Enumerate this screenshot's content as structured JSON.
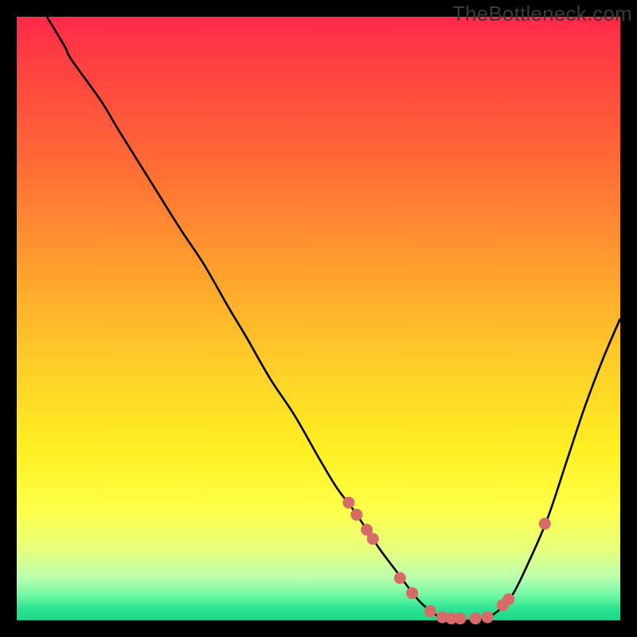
{
  "watermark": "TheBottleneck.com",
  "colors": {
    "curve_stroke": "#000000",
    "point_fill": "#d96a6a",
    "point_stroke": "#d96a6a"
  },
  "chart_data": {
    "type": "line",
    "title": "",
    "xlabel": "",
    "ylabel": "",
    "xlim": [
      0,
      100
    ],
    "ylim": [
      0,
      100
    ],
    "grid": false,
    "legend": false,
    "series": [
      {
        "name": "bottleneck-curve",
        "x": [
          5,
          8,
          9,
          14,
          17,
          22,
          27,
          31,
          35,
          38,
          42,
          46,
          50,
          53,
          56,
          60,
          63,
          66,
          68,
          71,
          73,
          76,
          79,
          82,
          85,
          88,
          91,
          94,
          97,
          100
        ],
        "y": [
          100,
          95,
          93,
          86,
          81,
          73,
          65,
          59,
          52,
          47,
          40,
          34,
          27,
          22,
          18,
          12,
          8,
          4,
          2,
          0,
          0,
          0,
          1,
          4,
          10,
          17,
          26,
          35,
          43,
          50
        ]
      }
    ],
    "points": {
      "name": "highlight-points",
      "r": 7,
      "x": [
        55.0,
        56.3,
        58.0,
        59.0,
        63.5,
        65.5,
        68.5,
        70.5,
        72.0,
        73.5,
        76.0,
        78.0,
        80.5,
        81.5,
        87.5
      ],
      "y": [
        19.5,
        17.5,
        15.0,
        13.5,
        7.0,
        4.5,
        1.5,
        0.5,
        0.3,
        0.3,
        0.3,
        0.5,
        2.5,
        3.5,
        16.0
      ]
    }
  }
}
